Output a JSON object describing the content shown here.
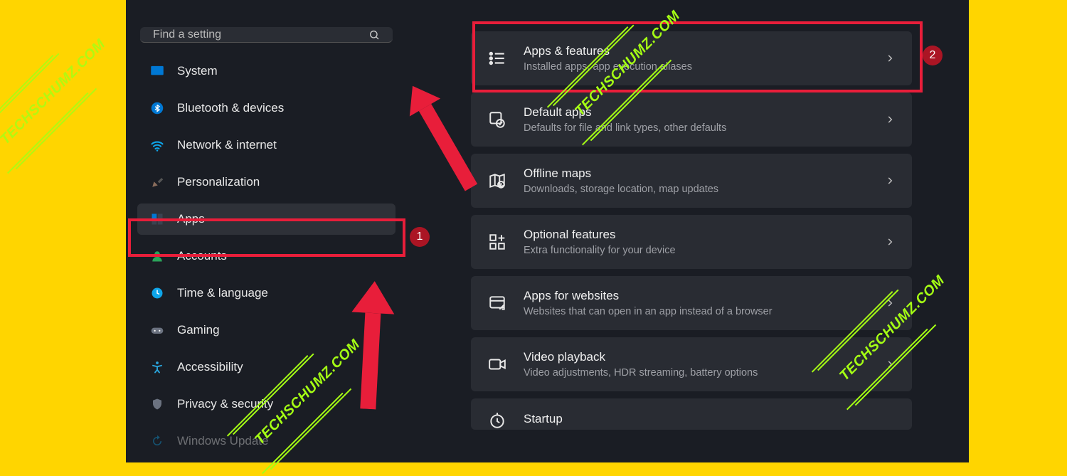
{
  "search": {
    "placeholder": "Find a setting"
  },
  "sidebar": {
    "items": [
      {
        "label": "System"
      },
      {
        "label": "Bluetooth & devices"
      },
      {
        "label": "Network & internet"
      },
      {
        "label": "Personalization"
      },
      {
        "label": "Apps"
      },
      {
        "label": "Accounts"
      },
      {
        "label": "Time & language"
      },
      {
        "label": "Gaming"
      },
      {
        "label": "Accessibility"
      },
      {
        "label": "Privacy & security"
      },
      {
        "label": "Windows Update"
      }
    ]
  },
  "cards": [
    {
      "title": "Apps & features",
      "subtitle": "Installed apps, app execution aliases"
    },
    {
      "title": "Default apps",
      "subtitle": "Defaults for file and link types, other defaults"
    },
    {
      "title": "Offline maps",
      "subtitle": "Downloads, storage location, map updates"
    },
    {
      "title": "Optional features",
      "subtitle": "Extra functionality for your device"
    },
    {
      "title": "Apps for websites",
      "subtitle": "Websites that can open in an app instead of a browser"
    },
    {
      "title": "Video playback",
      "subtitle": "Video adjustments, HDR streaming, battery options"
    },
    {
      "title": "Startup",
      "subtitle": ""
    }
  ],
  "annotations": {
    "badge1": "1",
    "badge2": "2"
  },
  "watermark": "TECHSCHUMZ.COM"
}
